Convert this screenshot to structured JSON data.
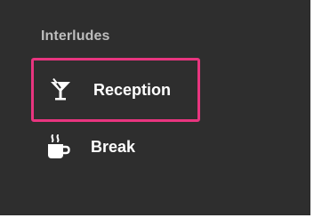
{
  "sidebar": {
    "section_title": "Interludes",
    "items": [
      {
        "label": "Reception",
        "icon": "cocktail-icon",
        "highlighted": true,
        "highlight_color": "#e8357f"
      },
      {
        "label": "Break",
        "icon": "coffee-cup-icon",
        "highlighted": false
      }
    ]
  },
  "colors": {
    "panel_background": "#2e2e2e",
    "section_title": "#bdbdbd",
    "item_label": "#ffffff"
  }
}
